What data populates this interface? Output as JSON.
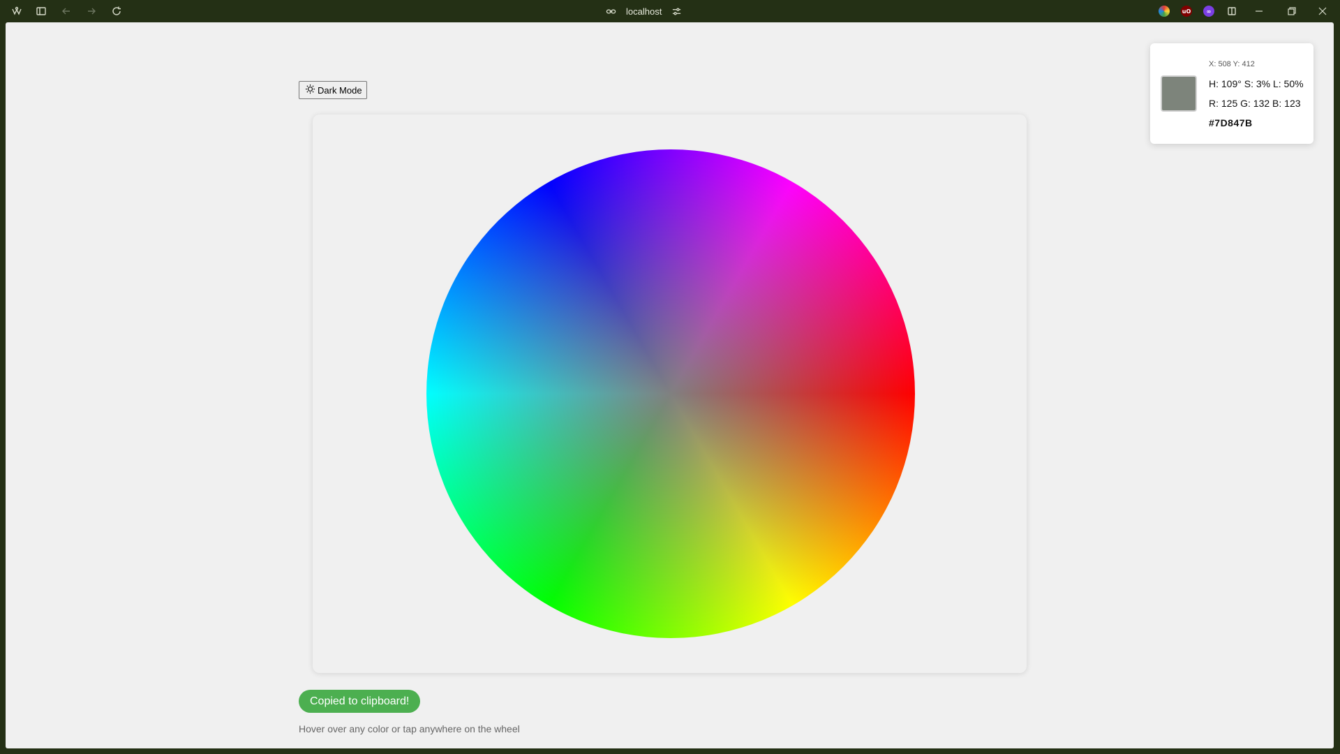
{
  "browser": {
    "url": "localhost",
    "extensions": [
      {
        "name": "extension-multicolor-icon",
        "color": "#2e7d32"
      },
      {
        "name": "ublock-origin-icon",
        "color": "#800000",
        "label": "uO"
      },
      {
        "name": "extension-purple-icon",
        "color": "#7b3fe4"
      }
    ]
  },
  "page": {
    "theme_toggle_label": "Dark Mode",
    "toast_text": "Copied to clipboard!",
    "hint_text": "Hover over any color or tap anywhere on the wheel",
    "accent_color": "#4caf50"
  },
  "color_info": {
    "coords": "X: 508 Y: 412",
    "hsl": "H: 109° S: 3% L: 50%",
    "rgb": "R: 125 G: 132 B: 123",
    "hex": "#7D847B",
    "swatch_color": "#7D847B"
  }
}
